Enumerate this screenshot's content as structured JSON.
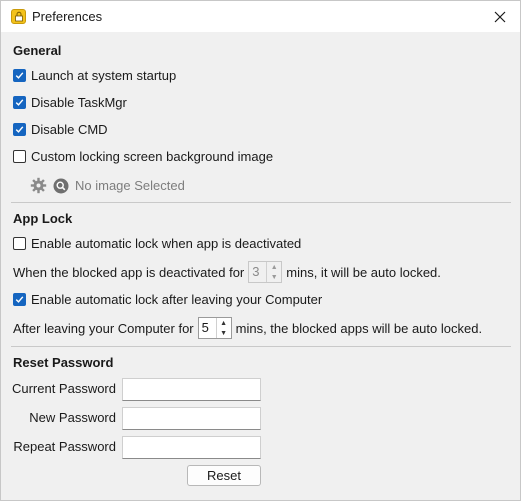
{
  "window": {
    "title": "Preferences",
    "icon": "lock-icon",
    "accent_color": "#1565c0"
  },
  "general": {
    "heading": "General",
    "launch_startup": {
      "label": "Launch at system startup",
      "checked": true
    },
    "disable_taskmgr": {
      "label": "Disable TaskMgr",
      "checked": true
    },
    "disable_cmd": {
      "label": "Disable CMD",
      "checked": true
    },
    "custom_bg": {
      "label": "Custom locking screen background image",
      "checked": false
    },
    "image_status": "No image Selected"
  },
  "app_lock": {
    "heading": "App Lock",
    "auto_lock_deactivated": {
      "label": "Enable automatic lock when app is deactivated",
      "checked": false
    },
    "deactivated_prefix": "When the blocked app is deactivated for",
    "deactivated_value": "3",
    "deactivated_suffix": "mins, it will be auto locked.",
    "auto_lock_leaving": {
      "label": "Enable automatic lock after leaving your Computer",
      "checked": true
    },
    "leaving_prefix": "After leaving your Computer for",
    "leaving_value": "5",
    "leaving_suffix": "mins, the blocked apps will be auto locked."
  },
  "reset_password": {
    "heading": "Reset Password",
    "current_label": "Current Password",
    "new_label": "New Password",
    "repeat_label": "Repeat Password",
    "current_value": "",
    "new_value": "",
    "repeat_value": "",
    "button_label": "Reset"
  }
}
